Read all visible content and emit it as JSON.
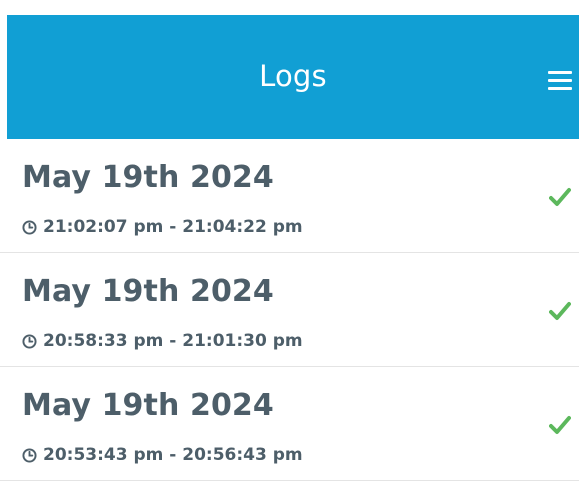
{
  "header": {
    "title": "Logs",
    "menu_icon": "hamburger-menu-icon",
    "background_color": "#119fd4"
  },
  "logs": [
    {
      "date": "May 19th 2024",
      "time_range": "21:02:07 pm - 21:04:22 pm",
      "status_icon": "check-icon",
      "status_color": "#5cb85c"
    },
    {
      "date": "May 19th 2024",
      "time_range": "20:58:33 pm - 21:01:30 pm",
      "status_icon": "check-icon",
      "status_color": "#5cb85c"
    },
    {
      "date": "May 19th 2024",
      "time_range": "20:53:43 pm - 20:56:43 pm",
      "status_icon": "check-icon",
      "status_color": "#5cb85c"
    }
  ]
}
